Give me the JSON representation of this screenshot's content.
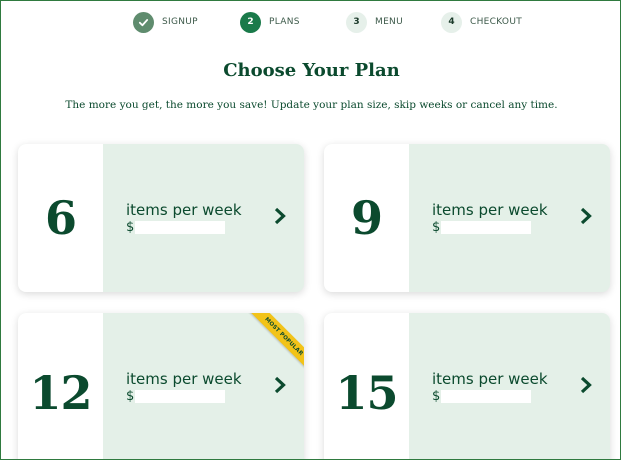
{
  "stepper": {
    "steps": [
      {
        "marker": "",
        "label": "SIGNUP",
        "state": "done"
      },
      {
        "marker": "2",
        "label": "PLANS",
        "state": "active"
      },
      {
        "marker": "3",
        "label": "MENU",
        "state": "todo"
      },
      {
        "marker": "4",
        "label": "CHECKOUT",
        "state": "todo"
      }
    ]
  },
  "header": {
    "title": "Choose Your Plan",
    "subtitle": "The more you get, the more you save! Update your plan size, skip weeks or cancel any time."
  },
  "plans": [
    {
      "count": "6",
      "unit_label": "items per week",
      "currency": "$",
      "badge": ""
    },
    {
      "count": "9",
      "unit_label": "items per week",
      "currency": "$",
      "badge": ""
    },
    {
      "count": "12",
      "unit_label": "items per week",
      "currency": "$",
      "badge": "MOST POPULAR"
    },
    {
      "count": "15",
      "unit_label": "items per week",
      "currency": "$",
      "badge": ""
    }
  ],
  "icons": {
    "done_step": "check-icon",
    "card_arrow": "chevron-right-icon"
  },
  "colors": {
    "brand_green": "#0b4a2e",
    "active_step": "#1a7a4a",
    "done_step": "#5f8c6e",
    "card_bg": "#e4f0e8",
    "badge": "#f2c318"
  }
}
